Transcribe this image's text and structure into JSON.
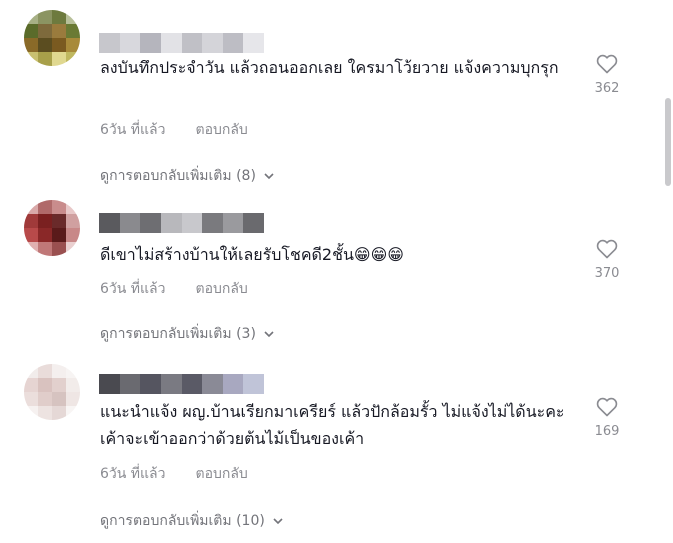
{
  "comments": [
    {
      "text": "ลงบันทึกประจำวัน แล้วถอนออกเลย ใครมาโว้ยวาย แจ้งความบุกรุก",
      "time": "6วัน ที่แล้ว",
      "reply": "ตอบกลับ",
      "likes": "362",
      "more_replies": "ดูการตอบกลับเพิ่มเติม (8)"
    },
    {
      "text": "ดีเขาไม่สร้างบ้านให้เลยรับโชคดี2ชั้น😁😁😁",
      "time": "6วัน ที่แล้ว",
      "reply": "ตอบกลับ",
      "likes": "370",
      "more_replies": "ดูการตอบกลับเพิ่มเติม (3)"
    },
    {
      "text": "แนะนำแจ้ง ผญ.บ้านเรียกมาเครียร์ แล้วปักล้อมรั้ว ไม่แจ้งไม่ได้นะคะ เค้าจะเข้าออกว่าด้วยต้นไม้เป็นของเค้า",
      "time": "6วัน ที่แล้ว",
      "reply": "ตอบกลับ",
      "likes": "169",
      "more_replies": "ดูการตอบกลับเพิ่มเติม (10)"
    }
  ],
  "icons": {
    "like": "heart-outline-icon",
    "expand": "chevron-down-icon"
  },
  "colors": {
    "text": "#161823",
    "secondary": "#8a8b91",
    "background": "#ffffff"
  }
}
